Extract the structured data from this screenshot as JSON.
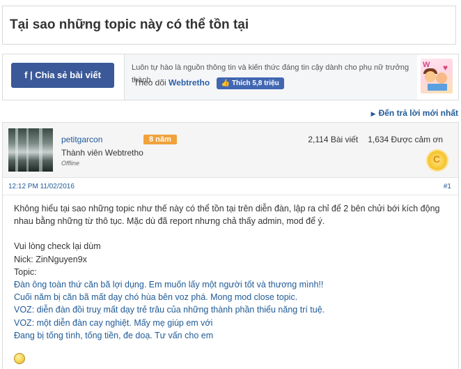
{
  "thread": {
    "title": "Tại sao những topic này có thể tồn tại"
  },
  "share": {
    "button_label": "f | Chia sẻ bài viết",
    "description": "Luôn tự hào là nguồn thông tin và kiến thức đáng tin cậy dành cho phụ nữ trưởng thành.",
    "follow_prefix": "Theo dõi",
    "brand": "Webtretho",
    "like_label": "Thích 5,8 triệu",
    "like_icon": "thumbs-up-icon",
    "logo_icon": "webtretho-logo"
  },
  "reply_link": {
    "label": "Đến trả lời mới nhất",
    "icon": "triangle-right-icon"
  },
  "post": {
    "username": "petitgarcon",
    "badge": "8 năm",
    "user_title": "Thành viên Webtretho",
    "status": "Offline",
    "posts_count": "2,114 Bài viết",
    "thanks_count": "1,634 Được cảm ơn",
    "timestamp": "12:12 PM 11/02/2016",
    "post_number": "#1",
    "paragraph1": "Không hiểu tại sao những topic như thế này có thể tồn tại trên diễn đàn, lập ra chỉ để 2 bên chửi bới kích động nhau bằng những từ thô tục. Mặc dù đã report nhưng chả thấy admin, mod để ý.",
    "line_check": "Vui lòng check lại dùm",
    "line_nick": "Nick: ZinNguyen9x",
    "line_topic": "Topic:",
    "topics": [
      "Đàn ông toàn thứ căn bã lợi dụng. Em muốn lấy một người tốt và thương mình!!",
      "Cuối năm bị căn bã mất dạy chó hùa bên voz phá. Mong mod close topic.",
      "VOZ: diễn đàn đồi truỵ mất dạy trẻ trâu của những thành phần thiểu năng trí tuệ.",
      "VOZ: một diễn đàn cay nghiệt. Mấy mẹ giúp em với",
      "Đang bị tống tình, tống tiền, đe doạ. Tư vấn cho em"
    ],
    "colors": {
      "link": "#1f5a96",
      "badge": "#f0a23b",
      "facebook": "#3b5998"
    }
  }
}
